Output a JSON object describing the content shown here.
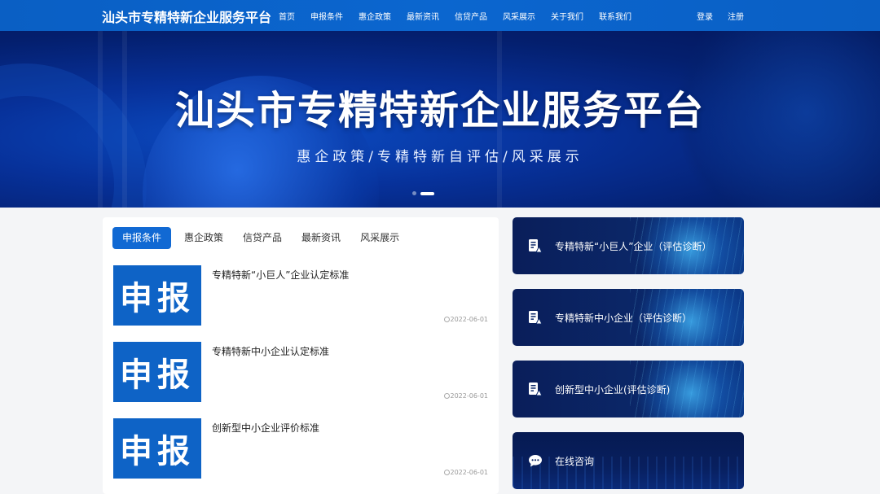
{
  "header": {
    "brand": "汕头市专精特新企业服务平台",
    "nav": [
      "首页",
      "申报条件",
      "惠企政策",
      "最新资讯",
      "信贷产品",
      "风采展示",
      "关于我们",
      "联系我们"
    ],
    "login": "登录",
    "register": "注册"
  },
  "banner": {
    "title": "汕头市专精特新企业服务平台",
    "subtitle": "惠企政策/专精特新自评估/风采展示",
    "slide_count": 2,
    "active_slide": 2
  },
  "content": {
    "tabs": [
      "申报条件",
      "惠企政策",
      "信贷产品",
      "最新资讯",
      "风采展示"
    ],
    "active_tab": "申报条件",
    "items": [
      {
        "thumb_text": "申报",
        "title": "专精特新“小巨人”企业认定标准",
        "date": "2022-06-01"
      },
      {
        "thumb_text": "申报",
        "title": "专精特新中小企业认定标准",
        "date": "2022-06-01"
      },
      {
        "thumb_text": "申报",
        "title": "创新型中小企业评价标准",
        "date": "2022-06-01"
      }
    ]
  },
  "services": [
    {
      "label": "专精特新“小巨人”企业（评估诊断）",
      "icon": "assessment-icon"
    },
    {
      "label": "专精特新中小企业（评估诊断）",
      "icon": "assessment-icon"
    },
    {
      "label": "创新型中小企业(评估诊断)",
      "icon": "assessment-icon"
    },
    {
      "label": "在线咨询",
      "icon": "chat-icon"
    }
  ],
  "colors": {
    "header_blue": "#0b66cf",
    "accent_blue": "#1169d3",
    "thumb_blue": "#0e63c6",
    "service_navy": "#0b2768"
  }
}
